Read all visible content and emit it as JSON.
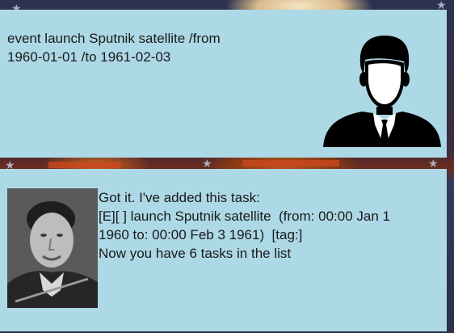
{
  "conversation": {
    "user_message": {
      "text": "event launch Sputnik satellite /from\n1960-01-01 /to 1961-02-03",
      "avatar_icon": "user-silhouette-icon"
    },
    "bot_message": {
      "text": "Got it. I've added this task:\n[E][ ] launch Sputnik satellite  (from: 00:00 Jan 1\n1960 to: 00:00 Feb 3 1961)  [tag:]\nNow you have 6 tasks in the list",
      "avatar_icon": "duke-portrait"
    }
  },
  "colors": {
    "bubble_background": "#add8e6",
    "text": "#1a1a1a",
    "silhouette": "#000000"
  }
}
